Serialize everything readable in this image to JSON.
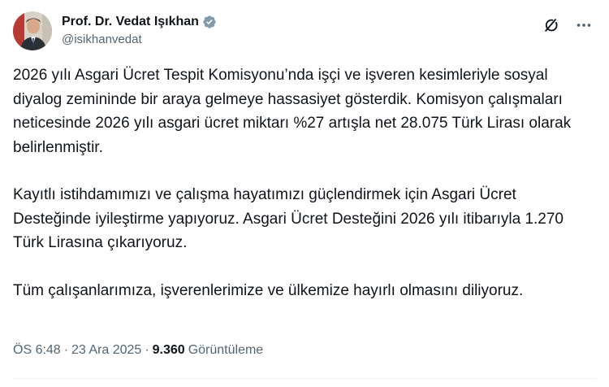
{
  "author": {
    "display_name": "Prof. Dr. Vedat Işıkhan",
    "handle": "@isikhanvedat",
    "verified": true,
    "verified_color": "#829aab"
  },
  "actions": {
    "grok_icon": "grok-icon",
    "more_icon": "more-icon"
  },
  "post": {
    "paragraphs": [
      "2026 yılı Asgari Ücret Tespit Komisyonu’nda işçi ve işveren kesimleriyle sosyal diyalog zemininde bir araya gelmeye hassasiyet gösterdik. Komisyon çalışmaları neticesinde 2026 yılı asgari ücret miktarı %27 artışla net 28.075 Türk Lirası olarak belirlenmiştir.",
      "Kayıtlı istihdamımızı ve çalışma hayatımızı güçlendirmek için Asgari Ücret Desteğinde iyileştirme yapıyoruz. Asgari Ücret Desteğini 2026 yılı itibarıyla 1.270 Türk Lirasına çıkarıyoruz.",
      "Tüm çalışanlarımıza, işverenlerimize ve ülkemize hayırlı olmasını diliyoruz."
    ]
  },
  "meta": {
    "time": "ÖS 6:48",
    "separator": "·",
    "date": "23 Ara 2025",
    "views_count": "9.360",
    "views_label": "Görüntüleme"
  }
}
